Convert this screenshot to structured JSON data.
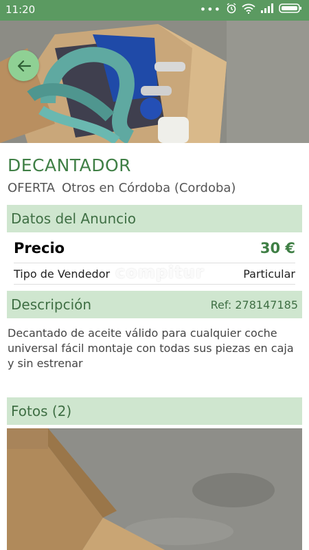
{
  "status_bar": {
    "time": "11:20",
    "icons": [
      "more-dots-icon",
      "alarm-icon",
      "wifi-icon",
      "signal-icon",
      "battery-icon"
    ]
  },
  "colors": {
    "brand_green": "#5b9a61",
    "title_green": "#3f7f45",
    "section_bg": "#cfe6cf",
    "back_button": "#8fd094"
  },
  "ad": {
    "title": "DECANTADOR",
    "offer_type": "OFERTA",
    "category_location": "Otros en Córdoba (Cordoba)"
  },
  "sections": {
    "details_header": "Datos del Anuncio",
    "description_header": "Descripción",
    "photos_header": "Fotos (2)"
  },
  "details": {
    "price_label": "Precio",
    "price_value": "30 €",
    "seller_label": "Tipo de Vendedor",
    "seller_value": "Particular"
  },
  "description": {
    "ref": "Ref: 278147185",
    "text": "Decantado de aceite válido para cualquier coche universal fácil montaje con todas sus piezas en caja y sin estrenar"
  },
  "watermark": "compitur"
}
